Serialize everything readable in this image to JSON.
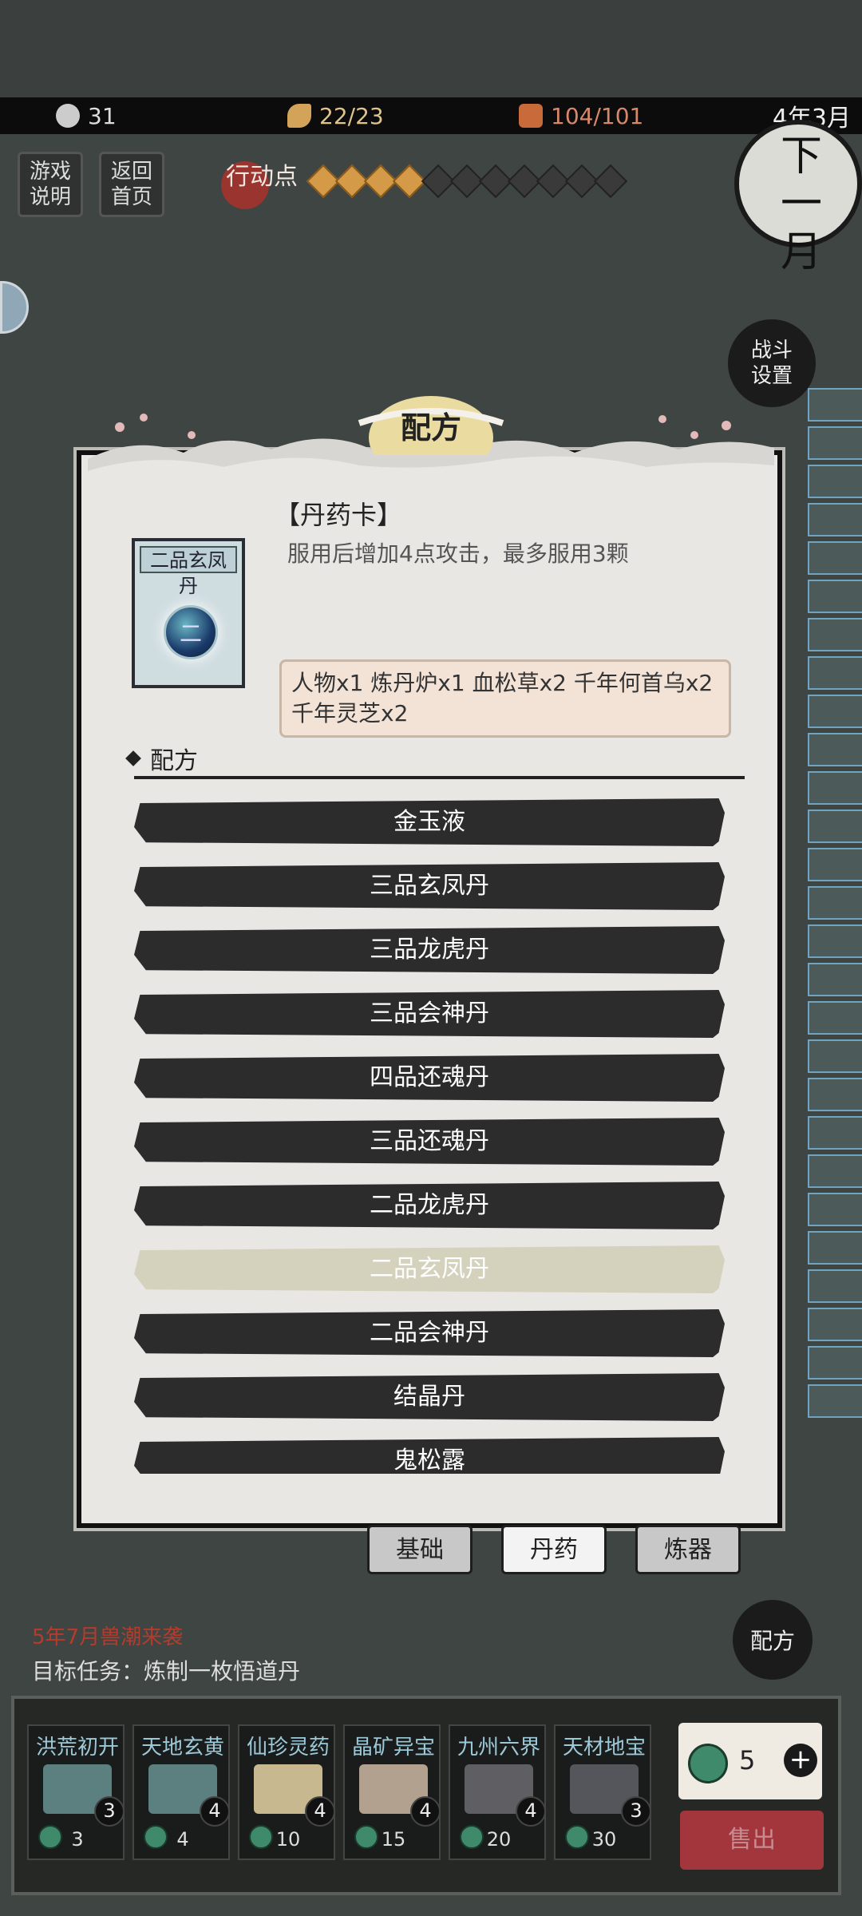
{
  "status_bar": {
    "level": "31",
    "stamina": "22/23",
    "cards": "104/101",
    "date": "4年3月"
  },
  "left_buttons": {
    "game_help": "游戏说明",
    "return_home": "返回首页"
  },
  "action_points": {
    "label": "行动点",
    "filled": 4,
    "total": 11
  },
  "next_month_button": "下一月",
  "battle_settings_button": "战斗设置",
  "modal": {
    "title": "配方",
    "card_title": "【丹药卡】",
    "card_name": "二品玄凤丹",
    "card_symbol": "二",
    "description": "服用后增加4点攻击，最多服用3颗",
    "ingredients": "人物x1 炼丹炉x1 血松草x2 千年何首乌x2 千年灵芝x2",
    "section_label": "配方",
    "recipes": [
      "金玉液",
      "三品玄凤丹",
      "三品龙虎丹",
      "三品会神丹",
      "四品还魂丹",
      "三品还魂丹",
      "二品龙虎丹",
      "二品玄凤丹",
      "二品会神丹",
      "结晶丹",
      "鬼松露"
    ],
    "selected_index": 7
  },
  "tabs": [
    "基础",
    "丹药",
    "炼器"
  ],
  "active_tab": 1,
  "event_text": "5年7月兽潮来袭",
  "mission_text": "目标任务：炼制一枚悟道丹",
  "recipe_circle": "配方",
  "packs": [
    {
      "name": "洪荒初开",
      "count": "3",
      "cost": "3",
      "color": "#5c7f80"
    },
    {
      "name": "天地玄黄",
      "count": "4",
      "cost": "4",
      "color": "#5c7f80"
    },
    {
      "name": "仙珍灵药",
      "count": "4",
      "cost": "10",
      "color": "#c8b88f"
    },
    {
      "name": "晶矿异宝",
      "count": "4",
      "cost": "15",
      "color": "#b2a18f"
    },
    {
      "name": "九州六界",
      "count": "4",
      "cost": "20",
      "color": "#5e5e63"
    },
    {
      "name": "天材地宝",
      "count": "3",
      "cost": "30",
      "color": "#55555c"
    }
  ],
  "coins": "5",
  "sell_button": "售出"
}
